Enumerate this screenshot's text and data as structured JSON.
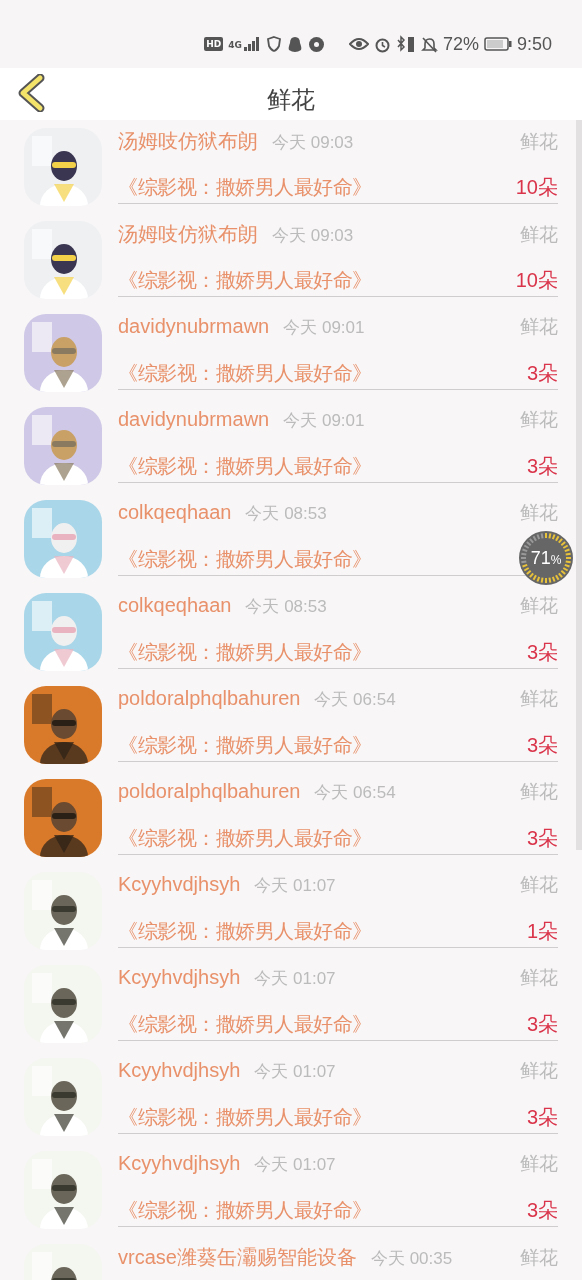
{
  "status_bar": {
    "network": "4G",
    "hd": "HD",
    "battery": "72%",
    "time": "9:50"
  },
  "header": {
    "title": "鲜花"
  },
  "rows": [
    {
      "name": "汤姆吱仿狱布朗",
      "time": "今天 09:03",
      "gift": "鲜花",
      "title": "《综影视：撒娇男人最好命》",
      "amount": "10朵"
    },
    {
      "name": "汤姆吱仿狱布朗",
      "time": "今天 09:03",
      "gift": "鲜花",
      "title": "《综影视：撒娇男人最好命》",
      "amount": "10朵"
    },
    {
      "name": "davidynubrmawn",
      "time": "今天 09:01",
      "gift": "鲜花",
      "title": "《综影视：撒娇男人最好命》",
      "amount": "3朵"
    },
    {
      "name": "davidynubrmawn",
      "time": "今天 09:01",
      "gift": "鲜花",
      "title": "《综影视：撒娇男人最好命》",
      "amount": "3朵"
    },
    {
      "name": "colkqeqhaan",
      "time": "今天 08:53",
      "gift": "鲜花",
      "title": "《综影视：撒娇男人最好命》"
    },
    {
      "name": "colkqeqhaan",
      "time": "今天 08:53",
      "gift": "鲜花",
      "title": "《综影视：撒娇男人最好命》",
      "amount": "3朵"
    },
    {
      "name": "poldoralphqlbahuren",
      "time": "今天 06:54",
      "gift": "鲜花",
      "title": "《综影视：撒娇男人最好命》",
      "amount": "3朵"
    },
    {
      "name": "poldoralphqlbahuren",
      "time": "今天 06:54",
      "gift": "鲜花",
      "title": "《综影视：撒娇男人最好命》",
      "amount": "3朵"
    },
    {
      "name": "Kcyyhvdjhsyh",
      "time": "今天 01:07",
      "gift": "鲜花",
      "title": "《综影视：撒娇男人最好命》",
      "amount": "1朵"
    },
    {
      "name": "Kcyyhvdjhsyh",
      "time": "今天 01:07",
      "gift": "鲜花",
      "title": "《综影视：撒娇男人最好命》",
      "amount": "3朵"
    },
    {
      "name": "Kcyyhvdjhsyh",
      "time": "今天 01:07",
      "gift": "鲜花",
      "title": "《综影视：撒娇男人最好命》",
      "amount": "3朵"
    },
    {
      "name": "Kcyyhvdjhsyh",
      "time": "今天 01:07",
      "gift": "鲜花",
      "title": "《综影视：撒娇男人最好命》",
      "amount": "3朵"
    },
    {
      "name": "vrcase潍葵缶灞赐智能设备",
      "time": "今天 00:35",
      "gift": "鲜花"
    }
  ],
  "floating_meter": {
    "reading": "71",
    "unit": "%"
  }
}
